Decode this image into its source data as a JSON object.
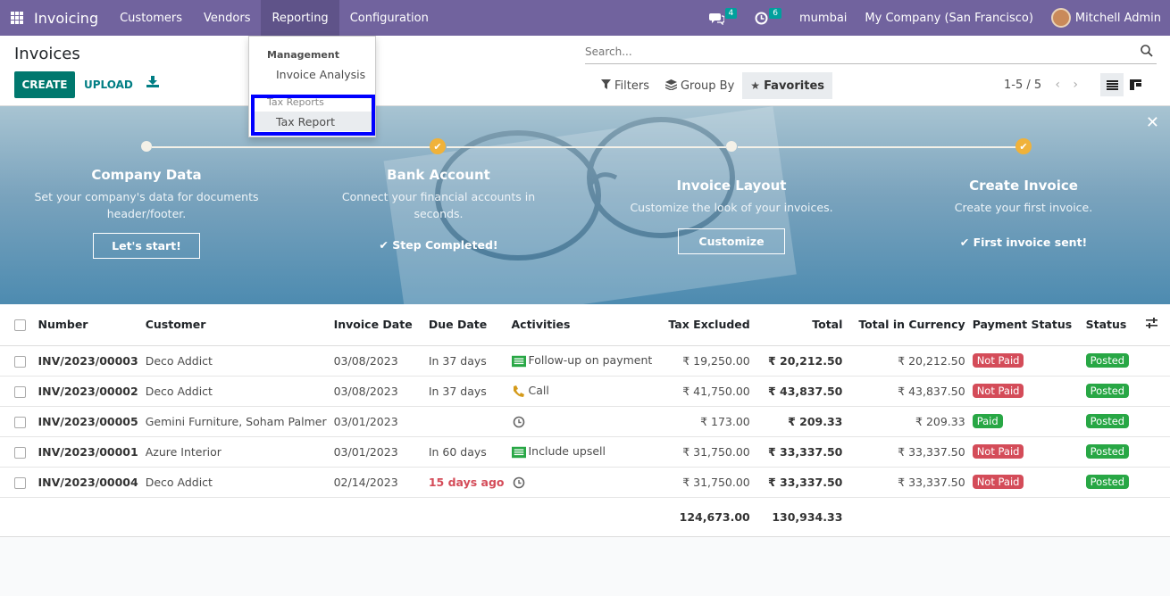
{
  "navbar": {
    "app_name": "Invoicing",
    "menu": [
      "Customers",
      "Vendors",
      "Reporting",
      "Configuration"
    ],
    "messages_count": "4",
    "activities_count": "6",
    "database": "mumbai",
    "company": "My Company (San Francisco)",
    "user": "Mitchell Admin"
  },
  "reporting_menu": {
    "section_management": "Management",
    "item_invoice_analysis": "Invoice Analysis",
    "section_tax_reports": "Tax Reports",
    "item_tax_report": "Tax Report"
  },
  "control_panel": {
    "title": "Invoices",
    "create_label": "CREATE",
    "upload_label": "UPLOAD",
    "search_placeholder": "Search...",
    "filters_label": "Filters",
    "group_by_label": "Group By",
    "favorites_label": "Favorites",
    "pager": "1-5 / 5"
  },
  "onboarding": {
    "steps": [
      {
        "title": "Company Data",
        "desc": "Set your company's data for documents header/footer.",
        "action": "Let's start!",
        "done": false
      },
      {
        "title": "Bank Account",
        "desc": "Connect your financial accounts in seconds.",
        "action": "Step Completed!",
        "done": true
      },
      {
        "title": "Invoice Layout",
        "desc": "Customize the look of your invoices.",
        "action": "Customize",
        "done": false
      },
      {
        "title": "Create Invoice",
        "desc": "Create your first invoice.",
        "action": "First invoice sent!",
        "done": true
      }
    ]
  },
  "table": {
    "columns": [
      "Number",
      "Customer",
      "Invoice Date",
      "Due Date",
      "Activities",
      "Tax Excluded",
      "Total",
      "Total in Currency",
      "Payment Status",
      "Status"
    ],
    "rows": [
      {
        "number": "INV/2023/00003",
        "customer": "Deco Addict",
        "invoice_date": "03/08/2023",
        "due_date": "In 37 days",
        "activity_icon": "email-activity-icon",
        "activity": "Follow-up on payment",
        "tax_excluded": "₹ 19,250.00",
        "total": "₹ 20,212.50",
        "total_currency": "₹ 20,212.50",
        "payment_status": "Not Paid",
        "status": "Posted"
      },
      {
        "number": "INV/2023/00002",
        "customer": "Deco Addict",
        "invoice_date": "03/08/2023",
        "due_date": "In 37 days",
        "activity_icon": "phone-icon",
        "activity": "Call",
        "tax_excluded": "₹ 41,750.00",
        "total": "₹ 43,837.50",
        "total_currency": "₹ 43,837.50",
        "payment_status": "Not Paid",
        "status": "Posted"
      },
      {
        "number": "INV/2023/00005",
        "customer": "Gemini Furniture, Soham Palmer",
        "invoice_date": "03/01/2023",
        "due_date": "",
        "activity_icon": "clock-icon",
        "activity": "",
        "tax_excluded": "₹ 173.00",
        "total": "₹ 209.33",
        "total_currency": "₹ 209.33",
        "payment_status": "Paid",
        "status": "Posted"
      },
      {
        "number": "INV/2023/00001",
        "customer": "Azure Interior",
        "invoice_date": "03/01/2023",
        "due_date": "In 60 days",
        "activity_icon": "email-activity-icon",
        "activity": "Include upsell",
        "tax_excluded": "₹ 31,750.00",
        "total": "₹ 33,337.50",
        "total_currency": "₹ 33,337.50",
        "payment_status": "Not Paid",
        "status": "Posted"
      },
      {
        "number": "INV/2023/00004",
        "customer": "Deco Addict",
        "invoice_date": "02/14/2023",
        "due_date": "15 days ago",
        "activity_icon": "clock-icon",
        "activity": "",
        "tax_excluded": "₹ 31,750.00",
        "total": "₹ 33,337.50",
        "total_currency": "₹ 33,337.50",
        "payment_status": "Not Paid",
        "status": "Posted"
      }
    ],
    "totals": {
      "tax_excluded": "124,673.00",
      "total": "130,934.33"
    }
  },
  "colors": {
    "navbar": "#71639e",
    "primary": "#00786e",
    "not_paid": "#d44c59",
    "paid_posted": "#28a745",
    "highlight_box": "#0000ff"
  }
}
